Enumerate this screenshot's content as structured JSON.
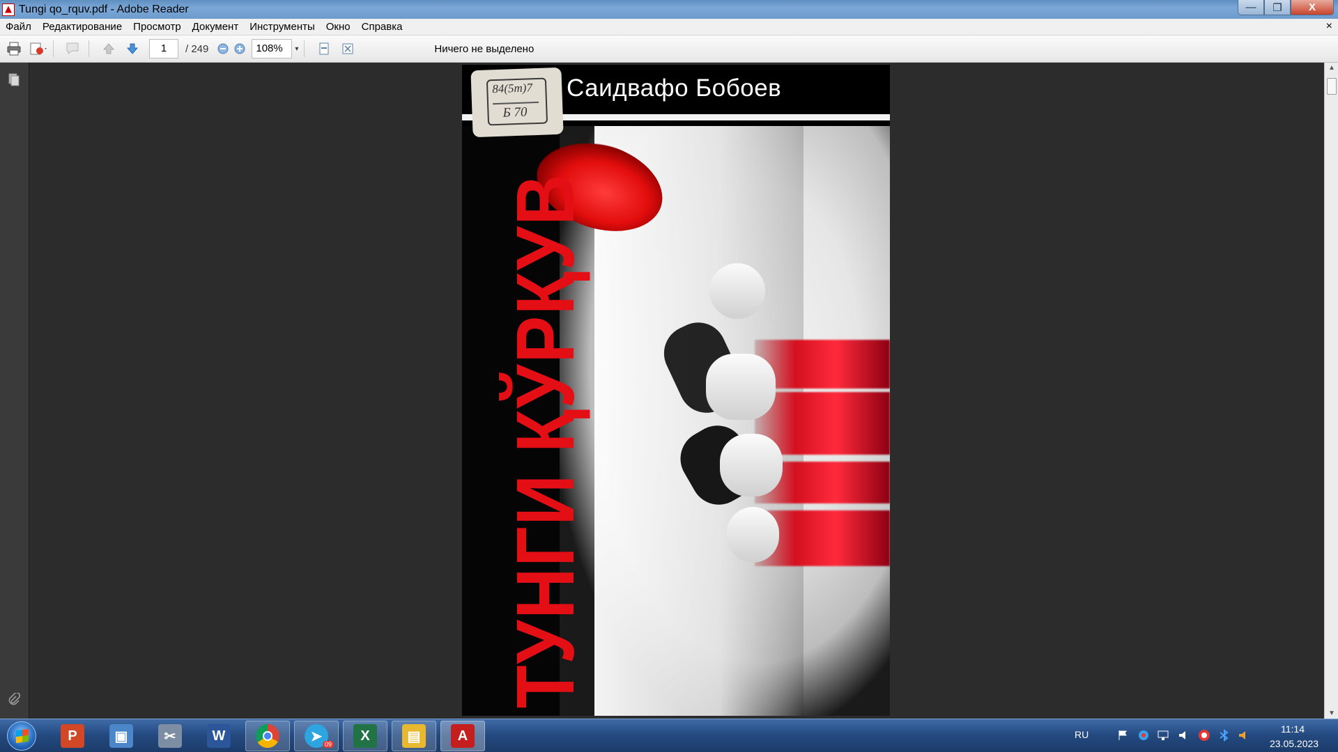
{
  "window": {
    "title": "Tungi qo_rquv.pdf - Adobe Reader",
    "controls": {
      "minimize": "—",
      "restore": "❐",
      "close": "X"
    }
  },
  "menu": {
    "items": [
      "Файл",
      "Редактирование",
      "Просмотр",
      "Документ",
      "Инструменты",
      "Окно",
      "Справка"
    ],
    "close_glyph": "×"
  },
  "toolbar": {
    "current_page": "1",
    "page_total": "/ 249",
    "zoom": "108%",
    "selection_status": "Ничего не выделено"
  },
  "document": {
    "author": "Саидвафо Бобоев",
    "title": "ТУНГИ ҚЎРҚУВ",
    "stamp_text_1": "84(5т)7",
    "stamp_text_2": "Б 70"
  },
  "taskbar": {
    "apps": [
      {
        "name": "powerpoint",
        "glyph": "P",
        "color": "#d24726"
      },
      {
        "name": "computer",
        "glyph": "▣",
        "color": "#4a86c8"
      },
      {
        "name": "snipping",
        "glyph": "✂",
        "color": "#7d8da3"
      },
      {
        "name": "word",
        "glyph": "W",
        "color": "#2b579a"
      },
      {
        "name": "chrome",
        "glyph": "●",
        "color": "#db4437"
      },
      {
        "name": "telegram",
        "glyph": "➤",
        "color": "#2ca5e0",
        "badge": "09"
      },
      {
        "name": "excel",
        "glyph": "X",
        "color": "#217346"
      },
      {
        "name": "explorer",
        "glyph": "▤",
        "color": "#e8b830"
      },
      {
        "name": "adobe-reader",
        "glyph": "A",
        "color": "#c41e1e"
      }
    ],
    "language": "RU",
    "time": "11:14",
    "date": "23.05.2023"
  },
  "colors": {
    "title_red": "#e30f15",
    "taskbar_blue": "#23497f"
  }
}
